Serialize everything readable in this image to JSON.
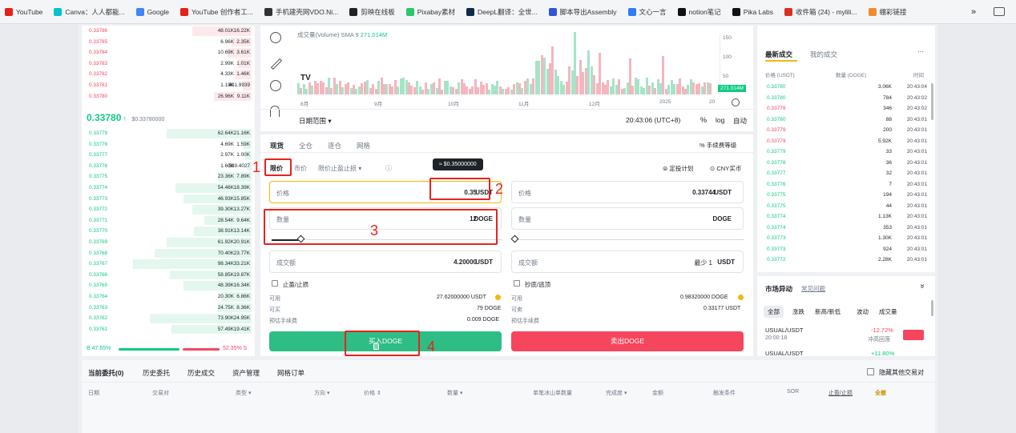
{
  "bookmarks": [
    {
      "label": "YouTube",
      "color": "#e62117"
    },
    {
      "label": "Canva：人人都能...",
      "color": "#00c4cc"
    },
    {
      "label": "Google",
      "color": "#4285f4"
    },
    {
      "label": "YouTube 创作者工...",
      "color": "#e62117"
    },
    {
      "label": "手机建壳网VDO.Ni...",
      "color": "#333333"
    },
    {
      "label": "剪映在线板",
      "color": "#222222"
    },
    {
      "label": "Pixabay素材",
      "color": "#2ec66d"
    },
    {
      "label": "DeepL翻译：全世...",
      "color": "#0f2b46"
    },
    {
      "label": "脚本导出Assembly",
      "color": "#3155d6"
    },
    {
      "label": "文心一言",
      "color": "#2f7df6"
    },
    {
      "label": "notion笔记",
      "color": "#111111"
    },
    {
      "label": "Pika Labs",
      "color": "#111111"
    },
    {
      "label": "收件箱 (24) - mylili...",
      "color": "#d93025"
    },
    {
      "label": "绷彩链接",
      "color": "#f28b30"
    }
  ],
  "bookmarks_more": "»",
  "orderbook": {
    "asks": [
      {
        "price": "0.33786",
        "amount": "48.01K",
        "total": "16.22K",
        "depth": 0.35
      },
      {
        "price": "0.33785",
        "amount": "6.96K",
        "total": "2.35K",
        "depth": 0.12
      },
      {
        "price": "0.33784",
        "amount": "10.69K",
        "total": "3.61K",
        "depth": 0.14
      },
      {
        "price": "0.33783",
        "amount": "2.99K",
        "total": "1.01K",
        "depth": 0.08
      },
      {
        "price": "0.33782",
        "amount": "4.33K",
        "total": "1.46K",
        "depth": 0.1
      },
      {
        "price": "0.33781",
        "amount": "1.19K",
        "total": "401.9939",
        "depth": 0.05
      },
      {
        "price": "0.33780",
        "amount": "26.96K",
        "total": "9.11K",
        "depth": 0.22
      }
    ],
    "last_price": "0.33780",
    "last_arrow": "↑",
    "last_usd": "$0.33780000",
    "bids": [
      {
        "price": "0.33779",
        "amount": "62.64K",
        "total": "21.16K",
        "depth": 0.5
      },
      {
        "price": "0.33778",
        "amount": "4.69K",
        "total": "1.59K",
        "depth": 0.05
      },
      {
        "price": "0.33777",
        "amount": "2.97K",
        "total": "1.00K",
        "depth": 0.04
      },
      {
        "price": "0.33776",
        "amount": "1.60K",
        "total": "539.4027",
        "depth": 0.03
      },
      {
        "price": "0.33775",
        "amount": "23.36K",
        "total": "7.89K",
        "depth": 0.2
      },
      {
        "price": "0.33774",
        "amount": "54.46K",
        "total": "18.39K",
        "depth": 0.45
      },
      {
        "price": "0.33773",
        "amount": "46.93K",
        "total": "15.85K",
        "depth": 0.4
      },
      {
        "price": "0.33772",
        "amount": "39.30K",
        "total": "13.27K",
        "depth": 0.35
      },
      {
        "price": "0.33771",
        "amount": "28.54K",
        "total": "9.64K",
        "depth": 0.28
      },
      {
        "price": "0.33770",
        "amount": "38.91K",
        "total": "13.14K",
        "depth": 0.34
      },
      {
        "price": "0.33769",
        "amount": "61.92K",
        "total": "20.91K",
        "depth": 0.5
      },
      {
        "price": "0.33768",
        "amount": "70.40K",
        "total": "23.77K",
        "depth": 0.57
      },
      {
        "price": "0.33767",
        "amount": "98.34K",
        "total": "33.21K",
        "depth": 0.7
      },
      {
        "price": "0.33766",
        "amount": "58.85K",
        "total": "19.87K",
        "depth": 0.48
      },
      {
        "price": "0.33765",
        "amount": "48.39K",
        "total": "16.34K",
        "depth": 0.4
      },
      {
        "price": "0.33764",
        "amount": "20.30K",
        "total": "6.86K",
        "depth": 0.18
      },
      {
        "price": "0.33763",
        "amount": "24.75K",
        "total": "8.36K",
        "depth": 0.2
      },
      {
        "price": "0.33762",
        "amount": "73.90K",
        "total": "24.95K",
        "depth": 0.6
      },
      {
        "price": "0.33761",
        "amount": "57.49K",
        "total": "19.41K",
        "depth": 0.47
      }
    ],
    "ratio_buy": "B 47.65%",
    "ratio_sell": "52.35% S"
  },
  "chart": {
    "volume_label": "成交量(Volume) SMA 9",
    "volume_value": "271.014M",
    "volume_tag": "271.014M",
    "y_ticks": [
      "150",
      "100",
      "50"
    ],
    "x_ticks": [
      "8月",
      "9月",
      "10月",
      "11月",
      "12月",
      "2025",
      "20"
    ],
    "tv_logo": "TV",
    "date_range": "日期范围",
    "time": "20:43:06 (UTC+8)",
    "pct": "%",
    "log": "log",
    "auto": "自动"
  },
  "trade": {
    "tabs": [
      "现货",
      "全仓",
      "逐仓",
      "网格"
    ],
    "fee_level": "手续费等级",
    "order_types": {
      "limit": "限价",
      "market": "市价",
      "stop": "限价止盈止损"
    },
    "info_icon": "ⓘ",
    "strategy": "定投计划",
    "cny": "CNY买币",
    "tooltip": "≈ $0.35000000",
    "buy": {
      "price_label": "价格",
      "price_value": "0.35",
      "price_unit": "USDT",
      "qty_label": "数量",
      "qty_value": "12",
      "qty_unit": "DOGE",
      "total_label": "成交额",
      "total_value": "4.20000",
      "total_unit": "USDT",
      "tpsl": "止盈/止损",
      "avail_label": "可用",
      "avail_value": "27.62000000 USDT",
      "can_buy_label": "可买",
      "can_buy_value": "79 DOGE",
      "fee_label": "预估手续费",
      "fee_value": "0.009 DOGE",
      "button": "买入DOGE"
    },
    "sell": {
      "price_label": "价格",
      "price_value": "0.33744",
      "price_unit": "USDT",
      "qty_label": "数量",
      "qty_unit": "DOGE",
      "total_label": "成交额",
      "total_hint": "最少 1",
      "total_unit": "USDT",
      "tpsl": "抄底/逃顶",
      "avail_label": "可用",
      "avail_value": "0.98320000 DOGE",
      "can_sell_label": "可卖",
      "can_sell_value": "0.33177 USDT",
      "fee_label": "预估手续费",
      "button": "卖出DOGE"
    }
  },
  "annotations": [
    "1",
    "2",
    "3",
    "4"
  ],
  "trades": {
    "tabs": [
      "最新成交",
      "我的成交"
    ],
    "more": "···",
    "headers": [
      "价格 (USDT)",
      "数量 (DOGE)",
      "时间"
    ],
    "rows": [
      {
        "price": "0.33780",
        "qty": "3.06K",
        "time": "20:43:04",
        "side": "buy"
      },
      {
        "price": "0.33780",
        "qty": "784",
        "time": "20:43:02",
        "side": "buy"
      },
      {
        "price": "0.33779",
        "qty": "346",
        "time": "20:43:02",
        "side": "sell"
      },
      {
        "price": "0.33780",
        "qty": "88",
        "time": "20:43:01",
        "side": "buy"
      },
      {
        "price": "0.33779",
        "qty": "200",
        "time": "20:43:01",
        "side": "sell"
      },
      {
        "price": "0.33779",
        "qty": "5.92K",
        "time": "20:43:01",
        "side": "sell"
      },
      {
        "price": "0.33779",
        "qty": "33",
        "time": "20:43:01",
        "side": "buy"
      },
      {
        "price": "0.33778",
        "qty": "36",
        "time": "20:43:01",
        "side": "buy"
      },
      {
        "price": "0.33777",
        "qty": "32",
        "time": "20:43:01",
        "side": "buy"
      },
      {
        "price": "0.33776",
        "qty": "7",
        "time": "20:43:01",
        "side": "buy"
      },
      {
        "price": "0.33775",
        "qty": "194",
        "time": "20:43:01",
        "side": "buy"
      },
      {
        "price": "0.33775",
        "qty": "44",
        "time": "20:43:01",
        "side": "buy"
      },
      {
        "price": "0.33774",
        "qty": "1.13K",
        "time": "20:43:01",
        "side": "buy"
      },
      {
        "price": "0.33774",
        "qty": "353",
        "time": "20:43:01",
        "side": "buy"
      },
      {
        "price": "0.33773",
        "qty": "1.30K",
        "time": "20:43:01",
        "side": "buy"
      },
      {
        "price": "0.33773",
        "qty": "924",
        "time": "20:43:01",
        "side": "buy"
      },
      {
        "price": "0.33772",
        "qty": "2.28K",
        "time": "20:43:01",
        "side": "buy"
      }
    ]
  },
  "market": {
    "title": "市场异动",
    "faq": "常见问题",
    "collapse": "»",
    "tabs": [
      "全部",
      "涨跌",
      "新高/新低",
      "波动",
      "成交量"
    ],
    "rows": [
      {
        "pair": "USUAL/USDT",
        "time": "20:00:18",
        "change": "-12.72%",
        "desc": "冲高回落"
      },
      {
        "pair": "USUAL/USDT",
        "change": "+11.80%"
      }
    ]
  },
  "orders": {
    "tabs": [
      "当前委托(0)",
      "历史委托",
      "历史成交",
      "资产管理",
      "网格订单"
    ],
    "hide_others": "隐藏其他交易对",
    "columns": [
      "日期",
      "交易对",
      "类型",
      "方向",
      "价格",
      "数量",
      "单笔冰山单数量",
      "完成度",
      "金额",
      "触发条件",
      "SOR",
      "止盈/止损",
      "全撤"
    ]
  }
}
